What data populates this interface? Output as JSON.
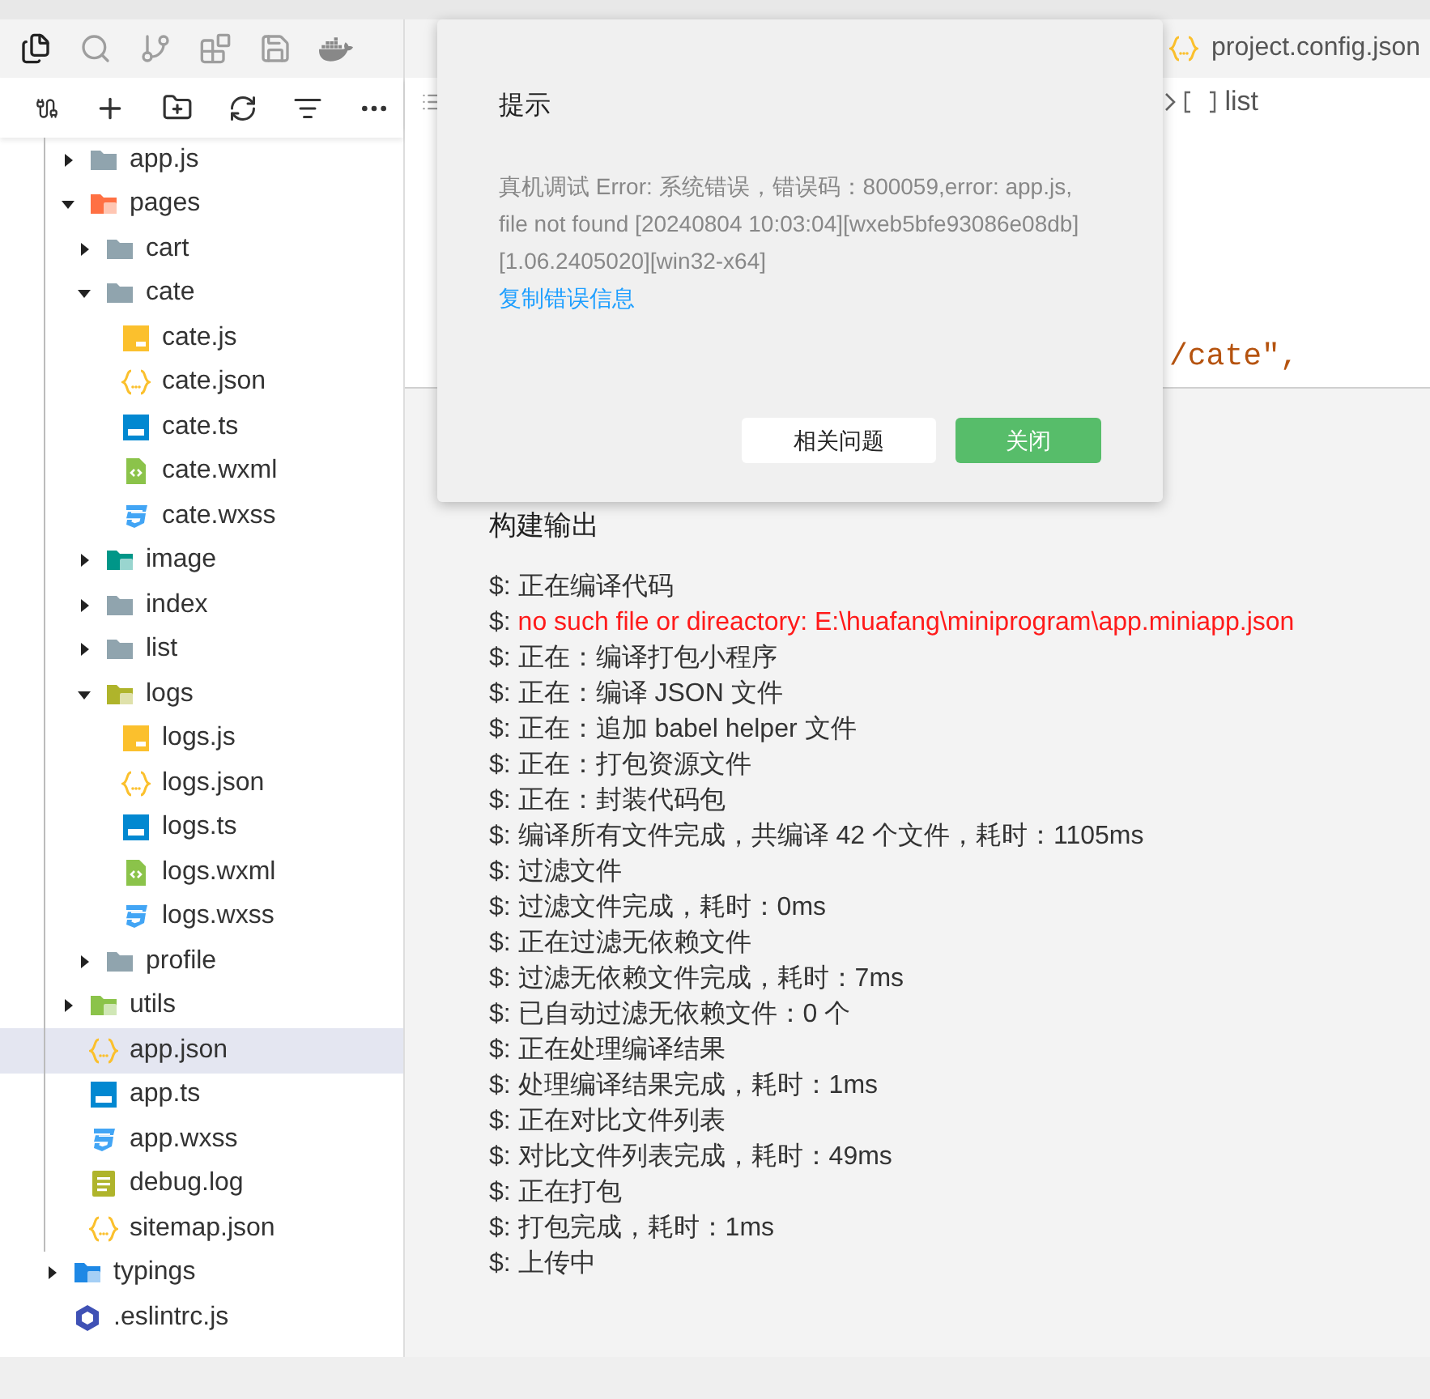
{
  "tabs": [
    {
      "label": "project.config.json",
      "kind": "json",
      "selected": false
    }
  ],
  "breadcrumb": {
    "label": "list"
  },
  "editor": {
    "code_line": "/cate\","
  },
  "tree": [
    {
      "children": [
        {
          "name": "app.js",
          "kind": "folder",
          "expanded": false,
          "selected": false
        },
        {
          "name": "pages",
          "kind": "folder-pages",
          "expanded": true,
          "selected": false,
          "children": [
            {
              "name": "cart",
              "kind": "folder",
              "expanded": false,
              "selected": false
            },
            {
              "name": "cate",
              "kind": "folder",
              "expanded": true,
              "selected": false,
              "children": [
                {
                  "name": "cate.js",
                  "kind": "js",
                  "selected": false
                },
                {
                  "name": "cate.json",
                  "kind": "json",
                  "selected": false
                },
                {
                  "name": "cate.ts",
                  "kind": "ts",
                  "selected": false
                },
                {
                  "name": "cate.wxml",
                  "kind": "wxml",
                  "selected": false
                },
                {
                  "name": "cate.wxss",
                  "kind": "wxss",
                  "selected": false
                }
              ]
            },
            {
              "name": "image",
              "kind": "folder-image",
              "expanded": false,
              "selected": false
            },
            {
              "name": "index",
              "kind": "folder",
              "expanded": false,
              "selected": false
            },
            {
              "name": "list",
              "kind": "folder",
              "expanded": false,
              "selected": false
            },
            {
              "name": "logs",
              "kind": "folder-logs",
              "expanded": true,
              "selected": false,
              "children": [
                {
                  "name": "logs.js",
                  "kind": "js",
                  "selected": false
                },
                {
                  "name": "logs.json",
                  "kind": "json",
                  "selected": false
                },
                {
                  "name": "logs.ts",
                  "kind": "ts",
                  "selected": false
                },
                {
                  "name": "logs.wxml",
                  "kind": "wxml",
                  "selected": false
                },
                {
                  "name": "logs.wxss",
                  "kind": "wxss",
                  "selected": false
                }
              ]
            },
            {
              "name": "profile",
              "kind": "folder",
              "expanded": false,
              "selected": false
            }
          ]
        },
        {
          "name": "utils",
          "kind": "folder-utils",
          "expanded": false,
          "selected": false
        },
        {
          "name": "app.json",
          "kind": "json",
          "selected": true
        },
        {
          "name": "app.ts",
          "kind": "ts",
          "selected": false
        },
        {
          "name": "app.wxss",
          "kind": "wxss",
          "selected": false
        },
        {
          "name": "debug.log",
          "kind": "log",
          "selected": false
        },
        {
          "name": "sitemap.json",
          "kind": "json",
          "selected": false
        }
      ]
    },
    {
      "name": "typings",
      "kind": "folder-typings",
      "expanded": false,
      "selected": false
    },
    {
      "name": ".eslintrc.js",
      "kind": "eslint",
      "selected": false
    }
  ],
  "output": {
    "title": "构建输出",
    "lines": [
      {
        "kind": "info",
        "text": "$: 正在编译代码"
      },
      {
        "kind": "error",
        "prefix": "$: ",
        "text": "no such file or direactory: E:\\huafang\\miniprogram\\app.miniapp.json"
      },
      {
        "kind": "info",
        "text": "$: 正在：编译打包小程序"
      },
      {
        "kind": "info",
        "text": "$: 正在：编译 JSON 文件"
      },
      {
        "kind": "info",
        "text": "$: 正在：追加 babel helper 文件"
      },
      {
        "kind": "info",
        "text": "$: 正在：打包资源文件"
      },
      {
        "kind": "info",
        "text": "$: 正在：封装代码包"
      },
      {
        "kind": "info",
        "text": "$: 编译所有文件完成，共编译 42 个文件，耗时：1105ms"
      },
      {
        "kind": "info",
        "text": "$: 过滤文件"
      },
      {
        "kind": "info",
        "text": "$: 过滤文件完成，耗时：0ms"
      },
      {
        "kind": "info",
        "text": "$: 正在过滤无依赖文件"
      },
      {
        "kind": "info",
        "text": "$: 过滤无依赖文件完成，耗时：7ms"
      },
      {
        "kind": "info",
        "text": "$: 已自动过滤无依赖文件：0 个"
      },
      {
        "kind": "info",
        "text": "$: 正在处理编译结果"
      },
      {
        "kind": "info",
        "text": "$: 处理编译结果完成，耗时：1ms"
      },
      {
        "kind": "info",
        "text": "$: 正在对比文件列表"
      },
      {
        "kind": "info",
        "text": "$: 对比文件列表完成，耗时：49ms"
      },
      {
        "kind": "info",
        "text": "$: 正在打包"
      },
      {
        "kind": "info",
        "text": "$: 打包完成，耗时：1ms"
      },
      {
        "kind": "info",
        "text": "$: 上传中"
      }
    ]
  },
  "dialog": {
    "title": "提示",
    "message": "真机调试 Error: 系统错误，错误码：800059,error: app.js, file not found [20240804 10:03:04][wxeb5bfe93086e08db] [1.06.2405020][win32-x64]",
    "link": "复制错误信息",
    "buttons": [
      {
        "label": "相关问题",
        "kind": "secondary"
      },
      {
        "label": "关闭",
        "kind": "primary"
      }
    ]
  }
}
